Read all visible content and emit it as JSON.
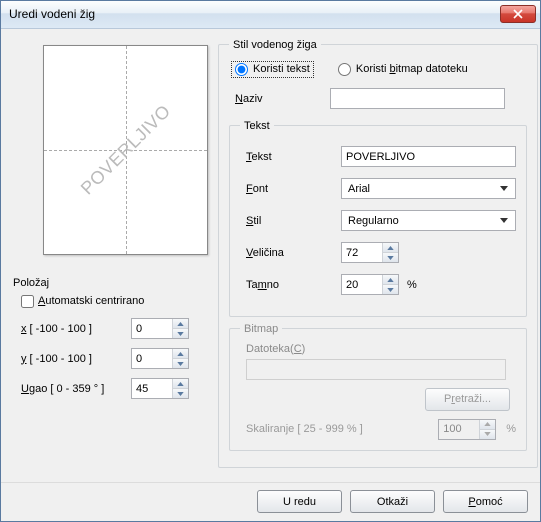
{
  "window": {
    "title": "Uredi vodeni žig"
  },
  "style_group": {
    "legend": "Stil vodenog žiga",
    "use_text": "Koristi tekst",
    "use_bitmap": "Koristi bitmap datoteku",
    "use_bitmap_und": "b",
    "selected": "text"
  },
  "name": {
    "label": "Naziv",
    "und": "N",
    "value": ""
  },
  "text_group": {
    "legend": "Tekst",
    "text_label": "Tekst",
    "text_und": "T",
    "text_value": "POVERLJIVO",
    "font_label": "Font",
    "font_und": "F",
    "font_value": "Arial",
    "style_label": "Stil",
    "style_und": "S",
    "style_value": "Regularno",
    "size_label": "Veličina",
    "size_und": "V",
    "size_value": "72",
    "shade_label": "Tamno",
    "shade_und": "m",
    "shade_value": "20",
    "shade_unit": "%"
  },
  "bitmap_group": {
    "legend": "Bitmap",
    "file_label": "Datoteka(C)",
    "file_und": "C",
    "browse": "Pretraži...",
    "browse_und": "r",
    "scale_label": "Skaliranje [ 25 - 999 % ]",
    "scale_value": "100",
    "scale_unit": "%"
  },
  "position": {
    "label": "Položaj",
    "auto_center": "Automatski centrirano",
    "auto_und": "A",
    "auto_checked": false,
    "x_label": "x [ -100 - 100 ]",
    "x_und": "x",
    "x_value": "0",
    "y_label": "y [ -100 - 100 ]",
    "y_und": "y",
    "y_value": "0",
    "angle_label": "Ugao [ 0 - 359 ° ]",
    "angle_und": "U",
    "angle_value": "45"
  },
  "preview": {
    "watermark": "POVERLJIVO"
  },
  "buttons": {
    "ok": "U redu",
    "cancel": "Otkaži",
    "help": "Pomoć",
    "help_und": "P"
  }
}
